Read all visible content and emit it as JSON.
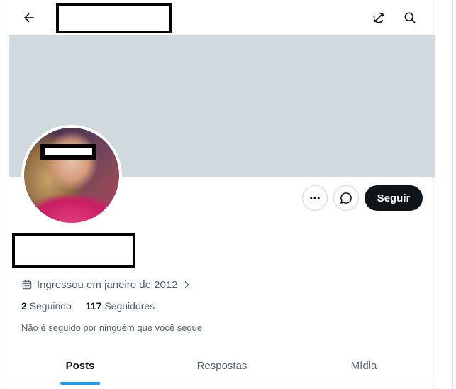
{
  "topbar": {
    "back_icon": "arrow-left-icon",
    "sync_icon": "sync-off-icon",
    "search_icon": "search-icon"
  },
  "profile": {
    "actions": {
      "more_icon": "more-horizontal-icon",
      "message_icon": "message-icon",
      "follow_label": "Seguir"
    },
    "joined_icon": "calendar-icon",
    "joined_text": "Ingressou em janeiro de 2012",
    "following_count": "2",
    "following_label": "Seguindo",
    "followers_count": "117",
    "followers_label": "Seguidores",
    "followed_by_note": "Não é seguido por ninguém que você segue"
  },
  "tabs": [
    {
      "label": "Posts",
      "active": true
    },
    {
      "label": "Respostas",
      "active": false
    },
    {
      "label": "Mídia",
      "active": false
    }
  ],
  "colors": {
    "banner": "#cfd9de",
    "accent": "#1d9bf0",
    "follow_button": "#0f1419",
    "secondary_text": "#536471"
  }
}
